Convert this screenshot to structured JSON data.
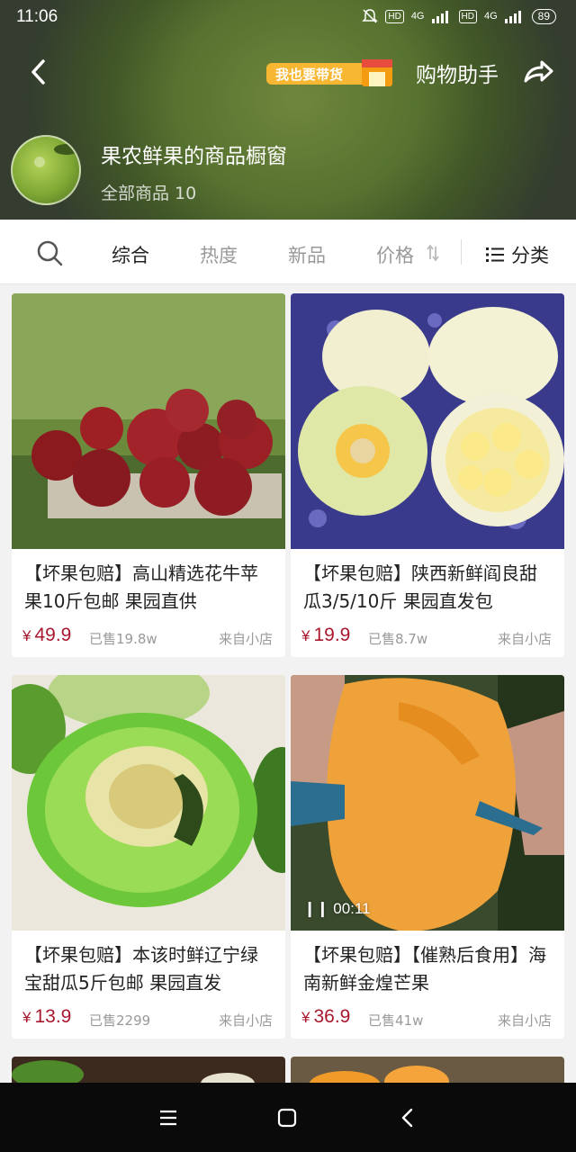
{
  "status_bar": {
    "time": "11:06",
    "signal_tags": [
      "HD",
      "4G",
      "HD",
      "4G"
    ],
    "battery": "89"
  },
  "header": {
    "promo_badge": "我也要带货",
    "assistant_label": "购物助手",
    "shop_name": "果农鲜果的商品橱窗",
    "product_count": "全部商品 10"
  },
  "tabs": {
    "items": [
      "综合",
      "热度",
      "新品",
      "价格"
    ],
    "active": "综合",
    "category_label": "分类"
  },
  "products": [
    {
      "title": "【坏果包赔】高山精选花牛苹果10斤包邮 果园直供",
      "currency": "¥",
      "price": "49.9",
      "sold": "已售19.8w",
      "origin": "来自小店",
      "image": "red-apples"
    },
    {
      "title": "【坏果包赔】陕西新鲜阎良甜瓜3/5/10斤 果园直发包",
      "currency": "¥",
      "price": "19.9",
      "sold": "已售8.7w",
      "origin": "来自小店",
      "image": "white-melons"
    },
    {
      "title": "【坏果包赔】本该时鲜辽宁绿宝甜瓜5斤包邮 果园直发",
      "currency": "¥",
      "price": "13.9",
      "sold": "已售2299",
      "origin": "来自小店",
      "image": "green-melon"
    },
    {
      "title": "【坏果包赔】【催熟后食用】海南新鲜金煌芒果",
      "currency": "¥",
      "price": "36.9",
      "sold": "已售41w",
      "origin": "来自小店",
      "image": "mango",
      "video_duration": "00:11"
    }
  ],
  "colors": {
    "price": "#a8182e",
    "muted": "#999999"
  }
}
